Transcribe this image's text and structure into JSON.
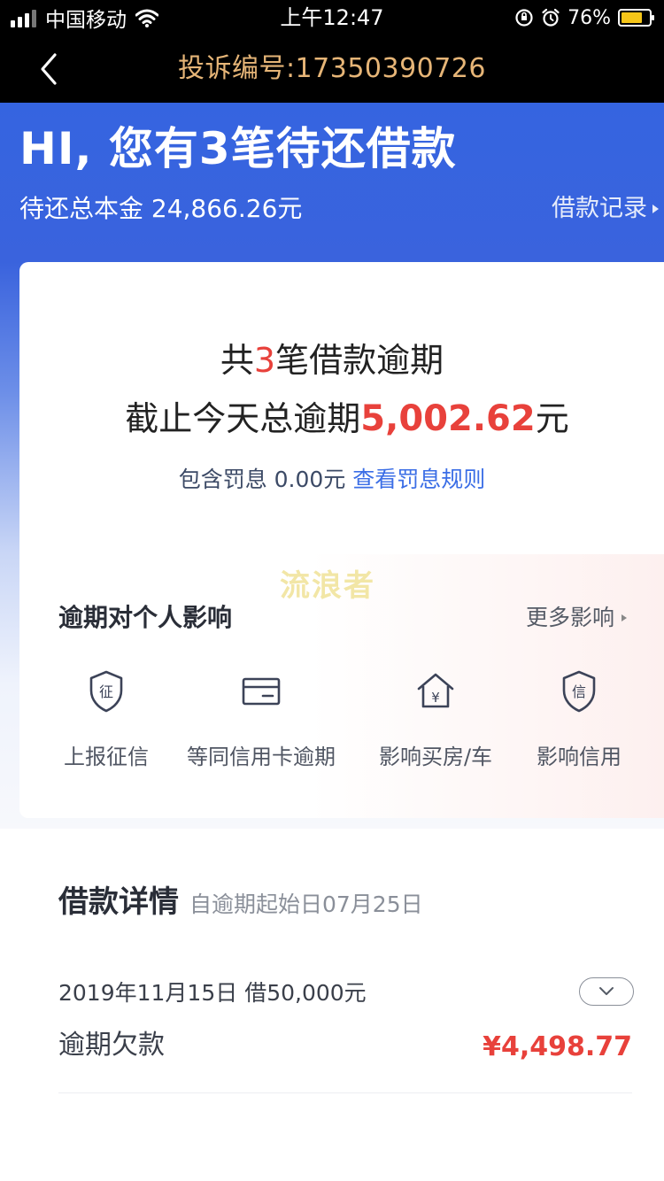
{
  "status_bar": {
    "carrier": "中国移动",
    "time": "上午12:47",
    "battery_percent": "76%"
  },
  "nav": {
    "title": "投诉编号:17350390726"
  },
  "hero": {
    "title": "HI, 您有3笔待还借款",
    "subtitle": "待还总本金 24,866.26元",
    "loan_record_link": "借款记录"
  },
  "overdue": {
    "line1_prefix": "共",
    "count": "3",
    "line1_suffix": "笔借款逾期",
    "line2_prefix": "截止今天总逾期",
    "amount": "5,002.62",
    "unit": "元",
    "penalty_text": "包含罚息 0.00元",
    "penalty_link": "查看罚息规则"
  },
  "watermark": "流浪者",
  "impact": {
    "title": "逾期对个人影响",
    "more_link": "更多影响",
    "items": [
      {
        "label": "上报征信",
        "icon": "credit-report-shield-icon",
        "glyph": "征"
      },
      {
        "label": "等同信用卡逾期",
        "icon": "credit-card-icon"
      },
      {
        "label": "影响买房/车",
        "icon": "house-yuan-icon",
        "glyph": "¥"
      },
      {
        "label": "影响信用",
        "icon": "credit-shield-icon",
        "glyph": "信"
      }
    ]
  },
  "detail": {
    "title": "借款详情",
    "subtitle": "自逾期起始日07月25日",
    "loan_date_amount": "2019年11月15日 借50,000元",
    "overdue_label": "逾期欠款",
    "overdue_amount": "¥4,498.77"
  },
  "colors": {
    "brand_blue": "#3564e0",
    "accent_red": "#e8413b",
    "link_blue": "#3b6ee6",
    "nav_title_gold": "#e6b577"
  }
}
